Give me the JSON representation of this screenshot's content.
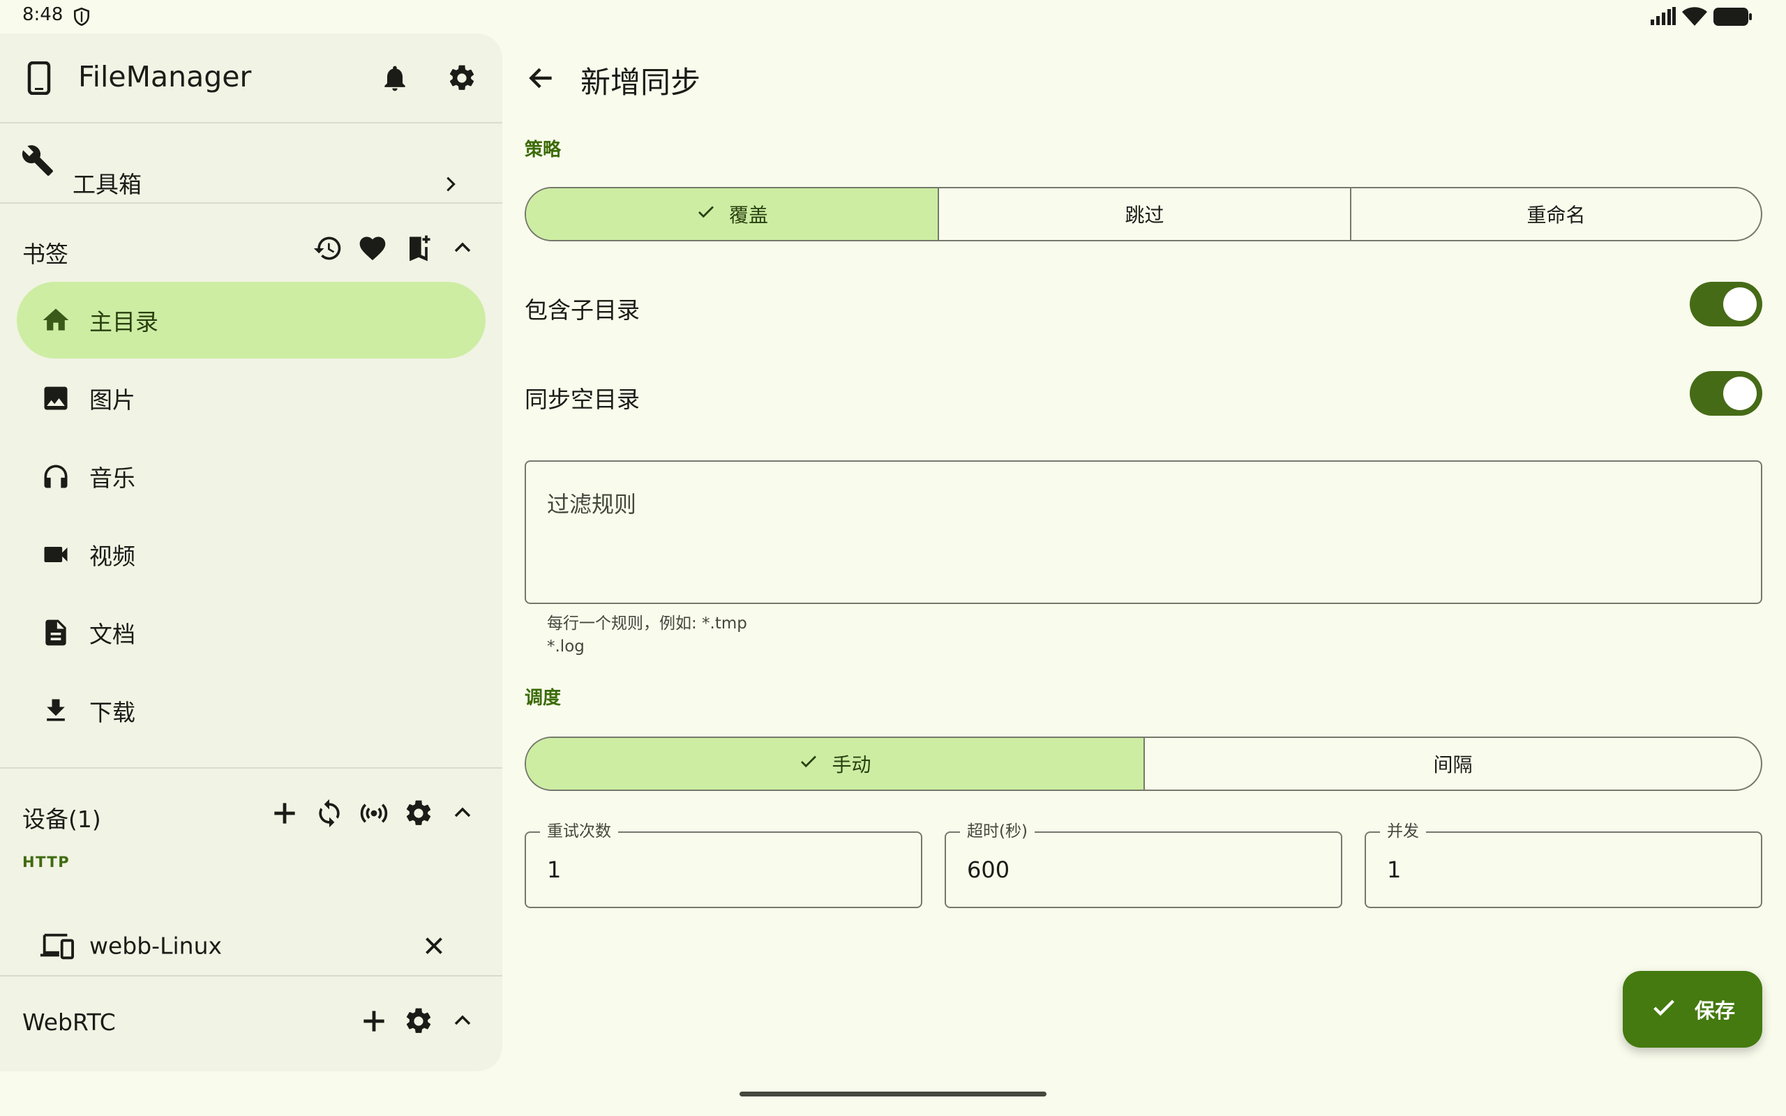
{
  "status_bar": {
    "time": "8:48"
  },
  "drawer": {
    "app_title": "FileManager",
    "toolbox_label": "工具箱",
    "bookmarks": {
      "section_title": "书签",
      "items": [
        {
          "label": "主目录",
          "icon": "home-icon",
          "active": true
        },
        {
          "label": "图片",
          "icon": "image-icon"
        },
        {
          "label": "音乐",
          "icon": "headphones-icon"
        },
        {
          "label": "视频",
          "icon": "videocam-icon"
        },
        {
          "label": "文档",
          "icon": "document-icon"
        },
        {
          "label": "下载",
          "icon": "download-icon"
        }
      ]
    },
    "devices": {
      "section_title": "设备(1)",
      "group_label": "HTTP",
      "device_name": "webb-Linux"
    },
    "webrtc": {
      "section_title": "WebRTC"
    }
  },
  "main": {
    "title": "新增同步",
    "strategy": {
      "label": "策略",
      "options": [
        "覆盖",
        "跳过",
        "重命名"
      ],
      "selected": 0
    },
    "include_subdirs": {
      "label": "包含子目录",
      "on": true
    },
    "sync_empty_dirs": {
      "label": "同步空目录",
      "on": true
    },
    "filter": {
      "placeholder": "过滤规则",
      "helper_line1": "每行一个规则，例如: *.tmp",
      "helper_line2": "*.log"
    },
    "schedule": {
      "label": "调度",
      "options": [
        "手动",
        "间隔"
      ],
      "selected": 0
    },
    "retry": {
      "label": "重试次数",
      "value": "1"
    },
    "timeout": {
      "label": "超时(秒)",
      "value": "600"
    },
    "concurrency": {
      "label": "并发",
      "value": "1"
    },
    "save_label": "保存"
  },
  "colors": {
    "accent": "#447a0f",
    "selected_container": "#cdeda3",
    "background": "#f9fbec",
    "drawer_bg": "#f1f3e4"
  }
}
